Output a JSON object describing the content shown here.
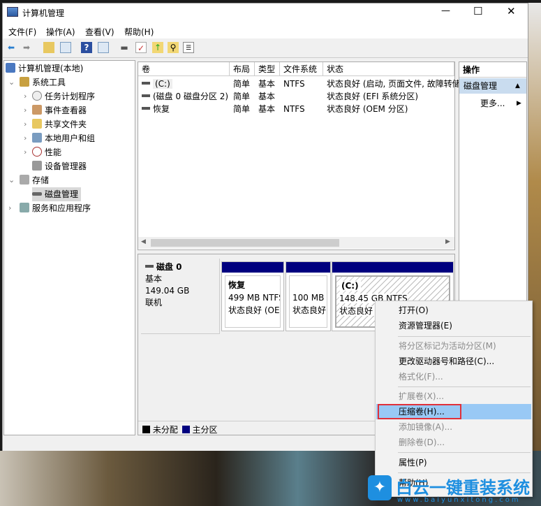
{
  "window": {
    "title": "计算机管理",
    "controls": [
      "—",
      "☐",
      "✕"
    ]
  },
  "menu": [
    "文件(F)",
    "操作(A)",
    "查看(V)",
    "帮助(H)"
  ],
  "tree": {
    "root": "计算机管理(本地)",
    "items": [
      {
        "label": "系统工具",
        "expanded": true
      },
      {
        "label": "任务计划程序"
      },
      {
        "label": "事件查看器"
      },
      {
        "label": "共享文件夹"
      },
      {
        "label": "本地用户和组"
      },
      {
        "label": "性能"
      },
      {
        "label": "设备管理器"
      },
      {
        "label": "存储",
        "expanded": true
      },
      {
        "label": "磁盘管理",
        "selected": true
      },
      {
        "label": "服务和应用程序"
      }
    ]
  },
  "list": {
    "columns": [
      "卷",
      "布局",
      "类型",
      "文件系统",
      "状态"
    ],
    "rows": [
      [
        "(C:)",
        "简单",
        "基本",
        "NTFS",
        "状态良好 (启动, 页面文件, 故障转储"
      ],
      [
        "(磁盘 0 磁盘分区 2)",
        "简单",
        "基本",
        "",
        "状态良好 (EFI 系统分区)"
      ],
      [
        "恢复",
        "简单",
        "基本",
        "NTFS",
        "状态良好 (OEM 分区)"
      ]
    ]
  },
  "disk": {
    "name": "磁盘 0",
    "type": "基本",
    "size": "149.04 GB",
    "status": "联机",
    "partitions": [
      {
        "name": "恢复",
        "size": "499 MB NTFS",
        "status": "状态良好 (OEM"
      },
      {
        "name": "",
        "size": "100 MB",
        "status": "状态良好"
      },
      {
        "name": "(C:)",
        "size": "148.45 GB NTFS",
        "status": "状态良好 ("
      }
    ]
  },
  "legend": [
    "未分配",
    "主分区"
  ],
  "colors": {
    "unallocated": "#000000",
    "primary": "#00007f",
    "highlight": "#99c9f5",
    "redbox": "#e0303a"
  },
  "actions": {
    "header": "操作",
    "section": "磁盘管理",
    "more": "更多..."
  },
  "context_menu": [
    {
      "label": "打开(O)"
    },
    {
      "label": "资源管理器(E)"
    },
    {
      "label": "将分区标记为活动分区(M)",
      "disabled": true
    },
    {
      "label": "更改驱动器号和路径(C)..."
    },
    {
      "label": "格式化(F)...",
      "disabled": true
    },
    {
      "label": "扩展卷(X)...",
      "disabled": true
    },
    {
      "label": "压缩卷(H)...",
      "highlighted": true
    },
    {
      "label": "添加镜像(A)...",
      "disabled": true
    },
    {
      "label": "删除卷(D)...",
      "disabled": true
    },
    {
      "label": "属性(P)"
    },
    {
      "label": "帮助(H)"
    }
  ],
  "watermark": {
    "brand": "白云一键重装系统",
    "url": "www.baiyunxitong.com"
  }
}
